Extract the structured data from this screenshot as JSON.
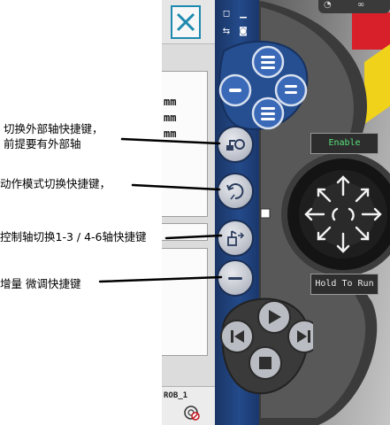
{
  "annotations": {
    "external_axis": "切换外部轴快捷键，\n前提要有外部轴",
    "external_axis_line1": "切换外部轴快捷键，",
    "external_axis_line2": "前提要有外部轴",
    "motion_mode": "动作模式切换快捷键，",
    "axis_switch": "控制轴切换1-3 / 4-6轴快捷键",
    "increment": "增量 微调快捷键"
  },
  "screen": {
    "unit_labels": [
      "mm",
      "mm",
      "mm"
    ],
    "robot_label": "ROB_1"
  },
  "jog_unit": {
    "enable_label": "Enable",
    "hold_to_run_label": "Hold To Run"
  },
  "colors": {
    "sidebar_blue": "#234a8a",
    "close_accent": "#1f8ab0",
    "enable_text": "#58e07a",
    "alert_red": "#d8202a",
    "alert_yellow": "#f1d21a"
  },
  "icons": {
    "close": "close-icon",
    "external_axis": "external-axis-icon",
    "motion_mode": "motion-mode-icon",
    "axis_switch": "axis-switch-icon",
    "increment": "increment-icon",
    "play": "play-icon",
    "stop": "stop-icon",
    "step_forward": "step-forward-icon",
    "step_backward": "step-backward-icon"
  }
}
